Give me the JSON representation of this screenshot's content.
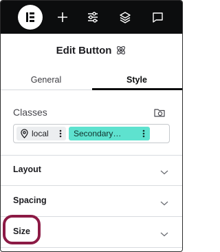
{
  "toolbar": {
    "logo_icon": "elementor-logo-icon",
    "add_icon": "plus-icon",
    "settings_icon": "sliders-icon",
    "structure_icon": "layers-icon",
    "comments_icon": "chat-bubble-icon",
    "background": "#0c0d0e"
  },
  "header": {
    "title": "Edit Button",
    "title_icon": "atom-icon"
  },
  "tabs": [
    {
      "label": "General",
      "active": false
    },
    {
      "label": "Style",
      "active": true
    }
  ],
  "classes": {
    "label": "Classes",
    "folder_icon": "folder-palette-icon",
    "chips": [
      {
        "label": "local",
        "icon": "map-pin-icon",
        "color": "#eceef0"
      },
      {
        "label": "Secondary…",
        "color": "#5ee2cf"
      }
    ]
  },
  "sections": [
    {
      "label": "Layout"
    },
    {
      "label": "Spacing"
    },
    {
      "label": "Size"
    }
  ],
  "highlight_color": "#8c1a45"
}
